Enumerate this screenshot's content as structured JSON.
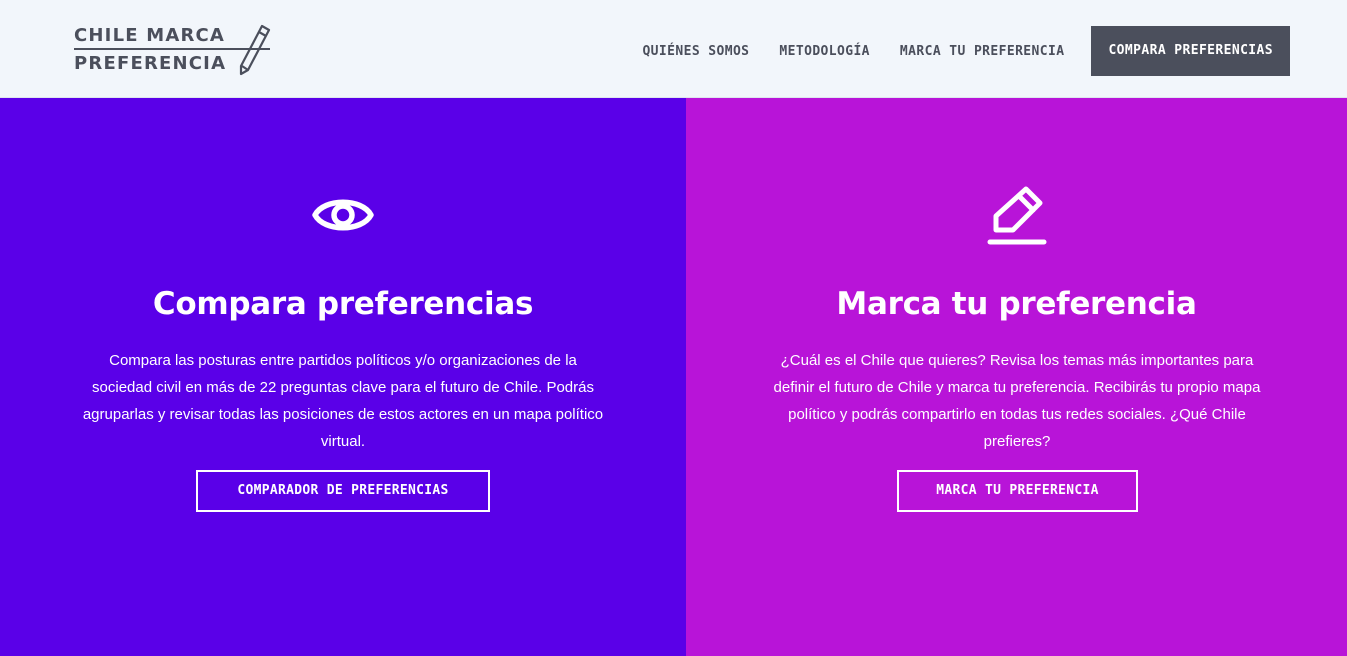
{
  "header": {
    "logo": {
      "line1": "CHILE MARCA",
      "line2": "PREFERENCIA",
      "icon": "pencil-icon"
    },
    "nav": [
      {
        "label": "QUIÉNES SOMOS"
      },
      {
        "label": "METODOLOGÍA"
      },
      {
        "label": "MARCA TU PREFERENCIA"
      }
    ],
    "cta_label": "COMPARA PREFERENCIAS"
  },
  "panels": [
    {
      "icon": "eye-icon",
      "title": "Compara preferencias",
      "text": "Compara las posturas entre partidos políticos y/o organizaciones de la sociedad civil en más de 22 preguntas clave para el futuro de Chile. Podrás agruparlas y revisar todas las posiciones de estos actores en un mapa político virtual.",
      "button": "COMPARADOR DE PREFERENCIAS",
      "color": "#5a00e8"
    },
    {
      "icon": "pencil-edit-icon",
      "title": "Marca tu preferencia",
      "text": "¿Cuál es el Chile que quieres? Revisa los temas más importantes para definir el futuro de Chile y marca tu preferencia. Recibirás tu propio mapa político y podrás compartirlo en todas tus redes sociales. ¿Qué Chile prefieres?",
      "button": "MARCA TU PREFERENCIA",
      "color": "#b814d8"
    }
  ]
}
